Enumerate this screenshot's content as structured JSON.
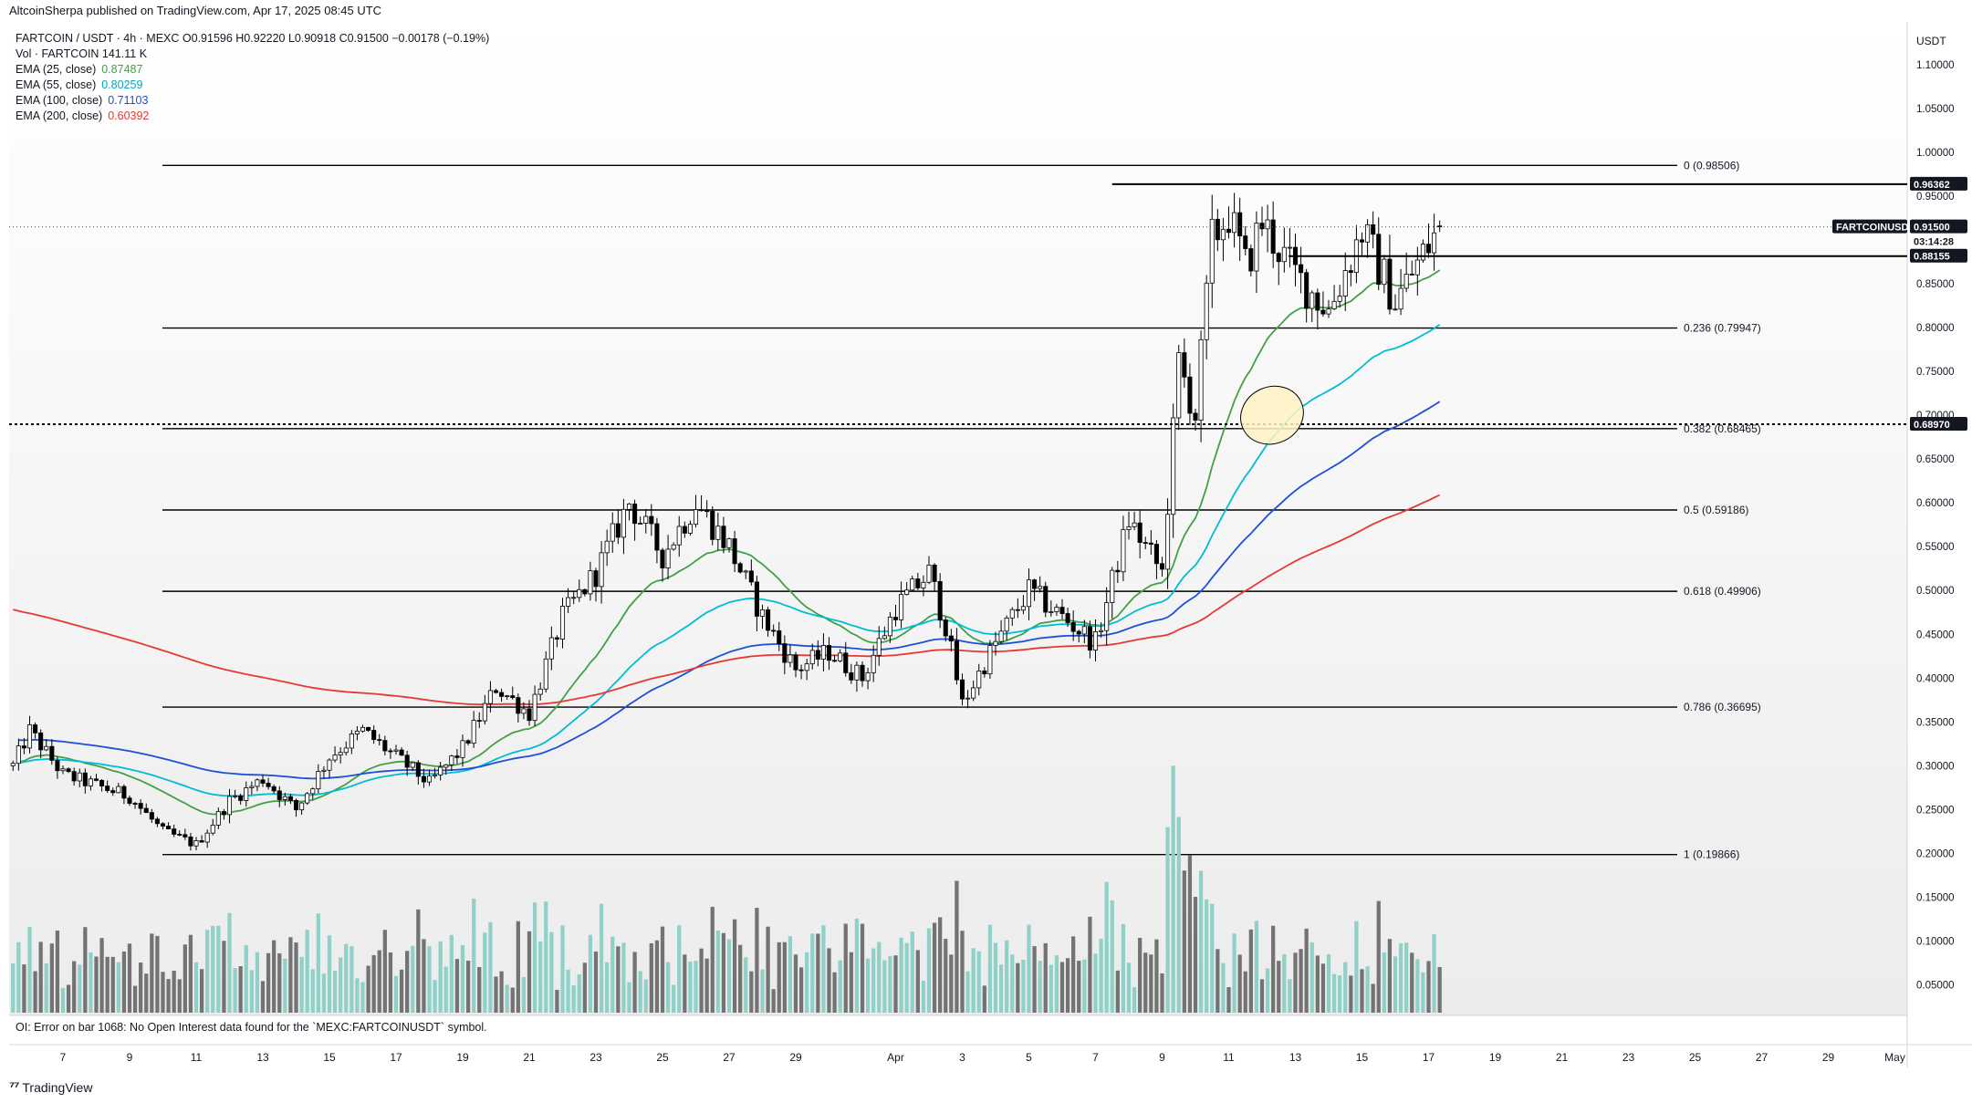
{
  "header": {
    "published": "AltcoinSherpa published on TradingView.com, Apr 17, 2025 08:45 UTC"
  },
  "legend": {
    "symbol_line": "FARTCOIN / USDT · 4h · MEXC  O0.91596  H0.92220  L0.90918  C0.91500  −0.00178 (−0.19%)",
    "vol_line": "Vol · FARTCOIN  141.11 K",
    "emas": [
      {
        "label": "EMA (25, close)",
        "value": "0.87487",
        "color": "#43a047"
      },
      {
        "label": "EMA (55, close)",
        "value": "0.80259",
        "color": "#00bcd4"
      },
      {
        "label": "EMA (100, close)",
        "value": "0.71103",
        "color": "#1e4fd8"
      },
      {
        "label": "EMA (200, close)",
        "value": "0.60392",
        "color": "#e53935"
      }
    ]
  },
  "price_axis": {
    "unit": "USDT",
    "ticks": [
      "1.10000",
      "1.05000",
      "1.00000",
      "0.95000",
      "0.90000",
      "0.85000",
      "0.80000",
      "0.75000",
      "0.70000",
      "0.65000",
      "0.60000",
      "0.55000",
      "0.50000",
      "0.45000",
      "0.40000",
      "0.35000",
      "0.30000",
      "0.25000",
      "0.20000",
      "0.15000",
      "0.10000",
      "0.05000"
    ],
    "tags": [
      {
        "text": "0.96362",
        "price": 0.96362,
        "style": "dark"
      },
      {
        "text": "FARTCOINUSDT",
        "price": 0.915,
        "style": "dark-name"
      },
      {
        "text": "0.91500",
        "price": 0.915,
        "style": "dark"
      },
      {
        "text": "03:14:28",
        "price": 0.8985,
        "style": "light"
      },
      {
        "text": "0.88155",
        "price": 0.88155,
        "style": "dark"
      },
      {
        "text": "0.68970",
        "price": 0.6897,
        "style": "dark"
      }
    ]
  },
  "time_axis": {
    "labels": [
      "7",
      "9",
      "11",
      "13",
      "15",
      "17",
      "19",
      "21",
      "23",
      "25",
      "27",
      "29",
      "Apr",
      "3",
      "5",
      "7",
      "9",
      "11",
      "13",
      "15",
      "17",
      "19",
      "21",
      "23",
      "25",
      "27",
      "29",
      "May"
    ]
  },
  "fib_levels": [
    {
      "label": "0 (0.98506)",
      "price": 0.98506
    },
    {
      "label": "0.236 (0.79947)",
      "price": 0.79947
    },
    {
      "label": "0.382 (0.68465)",
      "price": 0.68465
    },
    {
      "label": "0.5 (0.59186)",
      "price": 0.59186
    },
    {
      "label": "0.618 (0.49906)",
      "price": 0.49906
    },
    {
      "label": "0.786 (0.36695)",
      "price": 0.36695
    },
    {
      "label": "1 (0.19866)",
      "price": 0.19866
    }
  ],
  "oi_error": "OI: Error on bar 1068: No Open Interest data found for the `MEXC:FARTCOINUSDT` symbol.",
  "brand": "TradingView",
  "colors": {
    "up_candle": "#ffffff",
    "down_candle": "#000000",
    "vol_up": "#8fd1c8",
    "vol_down": "#737373",
    "ellipse": "#fff3c4"
  },
  "chart_data": {
    "type": "candlestick",
    "title": "FARTCOIN / USDT · 4h · MEXC",
    "ylim": [
      0.02,
      1.14
    ],
    "x_range": [
      "Mar 5",
      "May 1"
    ],
    "time_labels": [
      "7",
      "9",
      "11",
      "13",
      "15",
      "17",
      "19",
      "21",
      "23",
      "25",
      "27",
      "29",
      "Apr",
      "3",
      "5",
      "7",
      "9",
      "11",
      "13",
      "15",
      "17",
      "19",
      "21",
      "23",
      "25",
      "27",
      "29",
      "May"
    ],
    "close_anchors": [
      {
        "t": "Mar 5 12:00",
        "close": 0.3
      },
      {
        "t": "Mar 6",
        "close": 0.34
      },
      {
        "t": "Mar 7",
        "close": 0.29
      },
      {
        "t": "Mar 9",
        "close": 0.265
      },
      {
        "t": "Mar 10",
        "close": 0.225
      },
      {
        "t": "Mar 11",
        "close": 0.21
      },
      {
        "t": "Mar 12",
        "close": 0.26
      },
      {
        "t": "Mar 13",
        "close": 0.285
      },
      {
        "t": "Mar 14",
        "close": 0.25
      },
      {
        "t": "Mar 15",
        "close": 0.31
      },
      {
        "t": "Mar 16",
        "close": 0.34
      },
      {
        "t": "Mar 17",
        "close": 0.31
      },
      {
        "t": "Mar 18",
        "close": 0.28
      },
      {
        "t": "Mar 19",
        "close": 0.32
      },
      {
        "t": "Mar 20",
        "close": 0.39
      },
      {
        "t": "Mar 21",
        "close": 0.36
      },
      {
        "t": "Mar 22",
        "close": 0.47
      },
      {
        "t": "Mar 23",
        "close": 0.52
      },
      {
        "t": "Mar 24",
        "close": 0.6
      },
      {
        "t": "Mar 25",
        "close": 0.54
      },
      {
        "t": "Mar 26",
        "close": 0.6
      },
      {
        "t": "Mar 27",
        "close": 0.55
      },
      {
        "t": "Mar 28",
        "close": 0.47
      },
      {
        "t": "Mar 29",
        "close": 0.41
      },
      {
        "t": "Mar 30",
        "close": 0.43
      },
      {
        "t": "Mar 31",
        "close": 0.4
      },
      {
        "t": "Apr 1",
        "close": 0.48
      },
      {
        "t": "Apr 2",
        "close": 0.52
      },
      {
        "t": "Apr 2 12:00",
        "close": 0.46
      },
      {
        "t": "Apr 3",
        "close": 0.37
      },
      {
        "t": "Apr 4",
        "close": 0.44
      },
      {
        "t": "Apr 5",
        "close": 0.5
      },
      {
        "t": "Apr 6",
        "close": 0.47
      },
      {
        "t": "Apr 7",
        "close": 0.44
      },
      {
        "t": "Apr 8",
        "close": 0.58
      },
      {
        "t": "Apr 9",
        "close": 0.52
      },
      {
        "t": "Apr 9 12:00",
        "close": 0.76
      },
      {
        "t": "Apr 10",
        "close": 0.7
      },
      {
        "t": "Apr 10 12:00",
        "close": 0.9
      },
      {
        "t": "Apr 11",
        "close": 0.93
      },
      {
        "t": "Apr 11 12:00",
        "close": 0.87
      },
      {
        "t": "Apr 12",
        "close": 0.92
      },
      {
        "t": "Apr 13",
        "close": 0.86
      },
      {
        "t": "Apr 14",
        "close": 0.82
      },
      {
        "t": "Apr 15",
        "close": 0.91
      },
      {
        "t": "Apr 16",
        "close": 0.83
      },
      {
        "t": "Apr 17 08:00",
        "close": 0.915
      }
    ],
    "ema_series": [
      {
        "name": "EMA (25, close)",
        "last": 0.87487
      },
      {
        "name": "EMA (55, close)",
        "last": 0.80259
      },
      {
        "name": "EMA (100, close)",
        "last": 0.71103
      },
      {
        "name": "EMA (200, close)",
        "last": 0.60392
      }
    ],
    "last_bar": {
      "open": 0.91596,
      "high": 0.9222,
      "low": 0.90918,
      "close": 0.915,
      "change": -0.00178,
      "change_pct": -0.19
    },
    "volume_last": "141.11 K",
    "horizontal_lines": [
      0.96362,
      0.88155,
      0.6897
    ],
    "fib_levels": [
      0.98506,
      0.79947,
      0.68465,
      0.59186,
      0.49906,
      0.36695,
      0.19866
    ]
  }
}
